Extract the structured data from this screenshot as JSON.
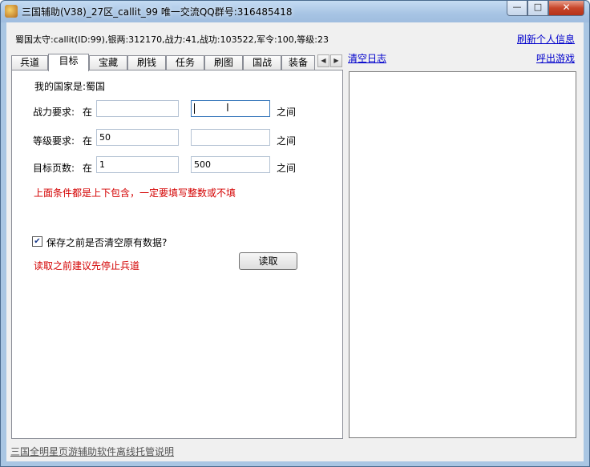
{
  "window": {
    "title": "三国辅助(V38)_27区_callit_99   唯一交流QQ群号:316485418",
    "min_label": "—",
    "max_label": "□",
    "close_label": "✕"
  },
  "header": {
    "info": "蜀国太守:callit(ID:99),银两:312170,战力:41,战功:103522,军令:100,等级:23",
    "refresh_link": "刷新个人信息",
    "clear_log_link": "清空日志",
    "call_game_link": "呼出游戏"
  },
  "tabs": [
    {
      "label": "兵道"
    },
    {
      "label": "目标"
    },
    {
      "label": "宝藏"
    },
    {
      "label": "刷钱"
    },
    {
      "label": "任务"
    },
    {
      "label": "刷图"
    },
    {
      "label": "国战"
    },
    {
      "label": "装备"
    }
  ],
  "tab_scroll": {
    "left": "◀",
    "right": "▶"
  },
  "panel": {
    "country_text": "我的国家是:蜀国",
    "rows": [
      {
        "label": "战力要求:",
        "in": "在",
        "min": "",
        "max": "",
        "between": "之间"
      },
      {
        "label": "等级要求:",
        "in": "在",
        "min": "50",
        "max": "",
        "between": "之间"
      },
      {
        "label": "目标页数:",
        "in": "在",
        "min": "1",
        "max": "500",
        "between": "之间"
      }
    ],
    "note": "上面条件都是上下包含，一定要填写整数或不填",
    "checkbox_label": "保存之前是否清空原有数据?",
    "checkbox_checked": true,
    "checkbox_mark": "✔",
    "hint": "读取之前建议先停止兵道",
    "read_button": "读取"
  },
  "footer": {
    "help_link": "三国全明星页游辅助软件离线托管说明"
  }
}
